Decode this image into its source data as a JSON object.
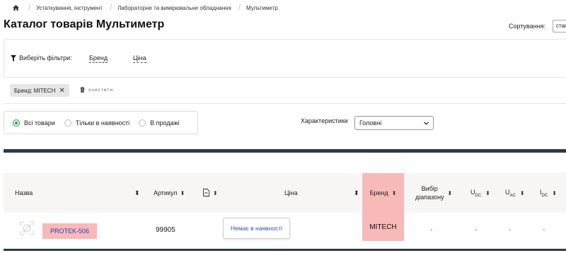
{
  "breadcrumb": {
    "items": [
      "Устаткування, інструмент",
      "Лабораторне та вимірювальне обладнання",
      "Мультиметр"
    ],
    "home_icon": "home-icon"
  },
  "page": {
    "title": "Каталог товарів Мультиметр"
  },
  "sort": {
    "label": "Сортування:",
    "value": "стан"
  },
  "filters": {
    "label": "Виберіть фільтри:",
    "items": [
      "Бренд",
      "Ціна"
    ]
  },
  "active_filters": {
    "chip": "Бренд: MITECH",
    "clear": "очистити"
  },
  "availability": {
    "options": [
      "Всі товари",
      "Тільки в наявності",
      "В продажі"
    ],
    "selected": 0
  },
  "characteristics": {
    "label": "Характеристики",
    "value": "Головні"
  },
  "table": {
    "headers": {
      "name": "Назва",
      "article": "Артикул",
      "price": "Ціна",
      "brand": "Бренд",
      "range_line1": "Вибір",
      "range_line2": "діапазону",
      "udc": "U",
      "udc_sub": "DC",
      "uac": "U",
      "uac_sub": "AC",
      "idc": "I",
      "idc_sub": "DC"
    },
    "rows": [
      {
        "name": "PROTEK-506",
        "article": "99905",
        "stock": "Немає в наявності",
        "brand": "MITECH",
        "range": "-",
        "udc": "-",
        "uac": "-",
        "idc": "-"
      }
    ]
  },
  "colors": {
    "accent_green": "#1ea23a",
    "highlight": "#f8b9b9",
    "link_blue": "#1f3fc0",
    "table_border": "#303848"
  }
}
